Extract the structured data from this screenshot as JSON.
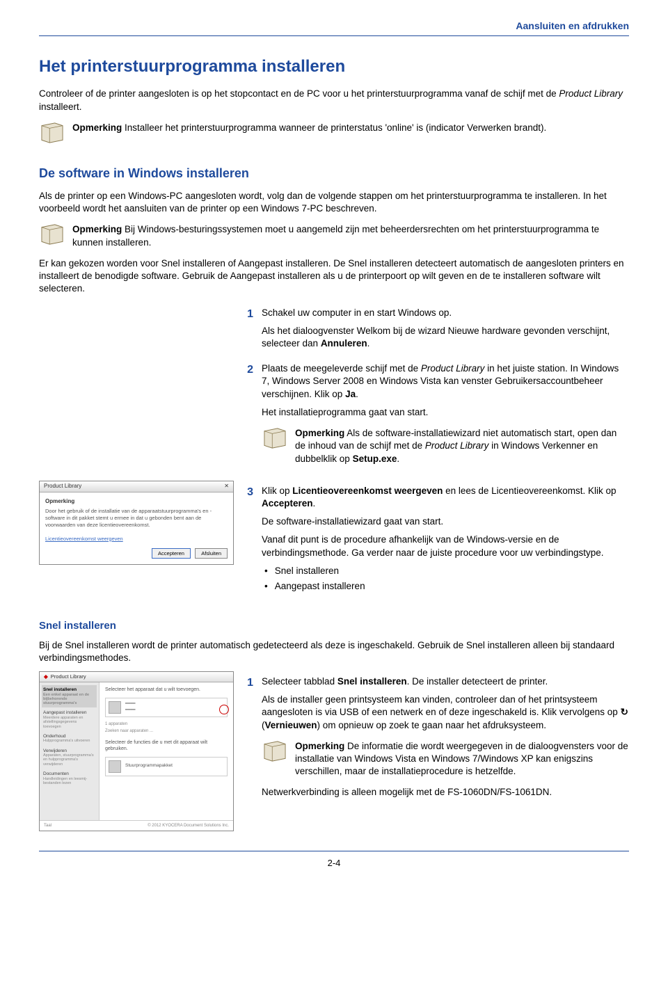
{
  "header": {
    "section_label": "Aansluiten en afdrukken"
  },
  "h1": "Het printerstuurprogramma installeren",
  "intro": {
    "p1a": "Controleer of de printer aangesloten is op het stopcontact en de PC voor u het printerstuurprogramma vanaf de schijf met de ",
    "p1_italic": "Product Library",
    "p1b": " installeert."
  },
  "note1": {
    "label": "Opmerking",
    "text": "  Installeer het printerstuurprogramma wanneer de printerstatus 'online' is (indicator Verwerken brandt)."
  },
  "h2": "De software in Windows installeren",
  "p2": "Als de printer op een Windows-PC aangesloten wordt, volg dan de volgende stappen om het printerstuurprogramma te installeren. In het voorbeeld wordt het aansluiten van de printer op een Windows 7-PC beschreven.",
  "note2": {
    "label": "Opmerking",
    "text": "  Bij Windows-besturingssystemen moet u aangemeld zijn met beheerdersrechten om het printerstuurprogramma te kunnen installeren."
  },
  "p3": "Er kan gekozen worden voor Snel installeren of Aangepast installeren. De Snel installeren detecteert automatisch de aangesloten printers en installeert de benodigde software. Gebruik de Aangepast installeren als u de printerpoort op wilt geven en de te installeren software wilt selecteren.",
  "steps_a": [
    {
      "num": "1",
      "parts": [
        {
          "t": "Schakel uw computer in en start Windows op."
        },
        {
          "t": "Als het dialoogvenster Welkom bij de wizard Nieuwe hardware gevonden verschijnt, selecteer dan ",
          "bold_after": "Annuleren",
          "tail": "."
        }
      ]
    },
    {
      "num": "2",
      "parts": [
        {
          "t_a": "Plaats de meegeleverde schijf met de ",
          "italic": "Product Library",
          "t_b": " in het juiste station. In Windows 7, Windows Server 2008 en Windows Vista kan venster Gebruikersaccountbeheer verschijnen. Klik op ",
          "bold": "Ja",
          "tail": "."
        },
        {
          "t": "Het installatieprogramma gaat van start."
        }
      ],
      "note": {
        "label": "Opmerking",
        "t_a": "  Als de software-installatiewizard niet automatisch start, open dan de inhoud van de schijf met de ",
        "italic": "Product Library",
        "t_b": " in Windows Verkenner en dubbelklik op ",
        "bold": "Setup.exe",
        "tail": "."
      }
    },
    {
      "num": "3",
      "parts": [
        {
          "t_a": "Klik op ",
          "bold1": "Licentieovereenkomst weergeven",
          "t_mid": " en lees de Licentieovereenkomst. Klik op ",
          "bold2": "Accepteren",
          "tail": "."
        },
        {
          "t": "De software-installatiewizard gaat van start."
        },
        {
          "t": "Vanaf dit punt is de procedure afhankelijk van de Windows-versie en de verbindingsmethode. Ga verder naar de juiste procedure voor uw verbindingstype."
        }
      ],
      "bullets": [
        "Snel installeren",
        "Aangepast installeren"
      ]
    }
  ],
  "dialog1": {
    "title": "Product Library",
    "heading": "Opmerking",
    "body": "Door het gebruik of de installatie van de apparaatstuurprogramma's en -software in dit pakket stemt u ermee in dat u gebonden bent aan de voorwaarden van deze licentieovereenkomst.",
    "link": "Licentieovereenkomst weergeven",
    "btn_accept": "Accepteren",
    "btn_close": "Afsluiten"
  },
  "h3": "Snel installeren",
  "p_si": "Bij de Snel installeren wordt de printer automatisch gedetecteerd als deze is ingeschakeld. Gebruik de Snel installeren alleen bij standaard verbindingsmethodes.",
  "installer": {
    "title": "Product Library",
    "side": {
      "snel": "Snel installeren",
      "snel_sub": "Een enkel apparaat en de bijbehorende stuurprogramma's",
      "aangepast": "Aangepast installeren",
      "aangepast_sub": "Meerdere apparaten en afstellingsgegevens toevoegen",
      "onderhoud": "Onderhoud",
      "onderhoud_sub": "Hulpprogramma's uitvoeren",
      "verwijderen": "Verwijderen",
      "verwijderen_sub": "Apparaten, stuurprogramma's en hulpprogramma's verwijderen",
      "docs": "Documenten",
      "docs_sub": "Handleidingen en leesmij-bestanden lezen"
    },
    "content": {
      "head": "Selecteer het apparaat dat u wilt toevoegen.",
      "count": "1 apparaten",
      "hint": "Zoeken naar apparaten ...",
      "sel_head": "Selecteer de functies die u met dit apparaat wilt gebruiken.",
      "feat": "Stuurprogrammapakket",
      "tool": "Taal"
    },
    "footer": "© 2012 KYOCERA Document Solutions Inc."
  },
  "steps_b": [
    {
      "num": "1",
      "parts": [
        {
          "t_a": "Selecteer tabblad ",
          "bold": "Snel installeren",
          "tail": ". De installer detecteert de printer."
        },
        {
          "t_a": "Als de installer geen printsysteem kan vinden, controleer dan of het printsysteem aangesloten is via USB of een netwerk en of deze ingeschakeld is. Klik vervolgens op ",
          "glyph": "↻",
          "t_mid": " (",
          "bold": "Vernieuwen",
          "tail": ") om opnieuw op zoek te gaan naar het afdruksysteem."
        }
      ],
      "note": {
        "label": "Opmerking",
        "text": "  De informatie die wordt weergegeven in de dialoogvensters voor de installatie van Windows Vista en Windows 7/Windows XP kan enigszins verschillen, maar de installatieprocedure is hetzelfde."
      },
      "trailing": "Netwerkverbinding is alleen mogelijk met de FS-1060DN/FS-1061DN."
    }
  ],
  "page_num": "2-4"
}
